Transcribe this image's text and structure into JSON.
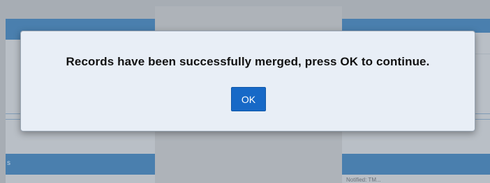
{
  "background": {
    "left_panel": {
      "header_label": "s"
    },
    "right_panel": {
      "footer_text": "Notified: TM..."
    }
  },
  "dialog": {
    "message": "Records have been successfully merged, press OK to continue.",
    "ok_label": "OK"
  },
  "colors": {
    "overlay_background": "#a7adb4",
    "panel_header": "#4a7fae",
    "dialog_background": "#e8eef6",
    "ok_button": "#1769c7",
    "ok_button_text": "#ffffff"
  }
}
